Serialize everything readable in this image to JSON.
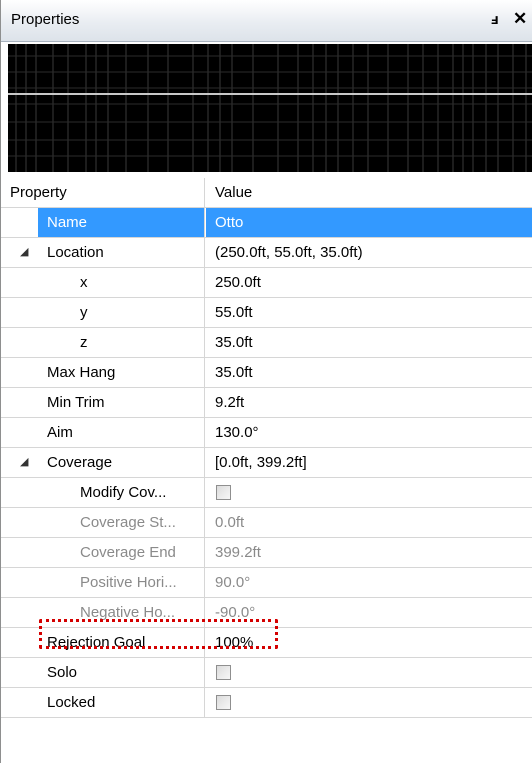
{
  "panel": {
    "title": "Properties",
    "pin_glyph": "ⅎ",
    "close_glyph": "✕"
  },
  "grid": {
    "header": {
      "property": "Property",
      "value": "Value"
    },
    "rows": [
      {
        "label": "Name",
        "value": "Otto",
        "selected": true
      },
      {
        "label": "Location",
        "value": "(250.0ft, 55.0ft, 35.0ft)",
        "expander": "◢"
      },
      {
        "label": "x",
        "value": "250.0ft"
      },
      {
        "label": "y",
        "value": "55.0ft"
      },
      {
        "label": "z",
        "value": "35.0ft"
      },
      {
        "label": "Max Hang",
        "value": "35.0ft"
      },
      {
        "label": "Min Trim",
        "value": "9.2ft"
      },
      {
        "label": "Aim",
        "value": "130.0°"
      },
      {
        "label": "Coverage",
        "value": "[0.0ft, 399.2ft]",
        "expander": "◢"
      },
      {
        "label": "Modify Cov...",
        "value": "",
        "checkbox": true,
        "checked": false
      },
      {
        "label": "Coverage St...",
        "value": "0.0ft",
        "disabled": true
      },
      {
        "label": "Coverage End",
        "value": "399.2ft",
        "disabled": true
      },
      {
        "label": "Positive Hori...",
        "value": "90.0°",
        "disabled": true
      },
      {
        "label": "Negative Ho...",
        "value": "-90.0°",
        "disabled": true,
        "highlighted": true
      },
      {
        "label": "Rejection Goal",
        "value": "100%"
      },
      {
        "label": "Solo",
        "value": "",
        "checkbox": true,
        "checked": false
      },
      {
        "label": "Locked",
        "value": "",
        "checkbox": true,
        "checked": false
      }
    ]
  },
  "colors": {
    "selection": "#3399ff",
    "highlight_outline": "#d40000",
    "disabled_text": "#8a8a8a"
  }
}
